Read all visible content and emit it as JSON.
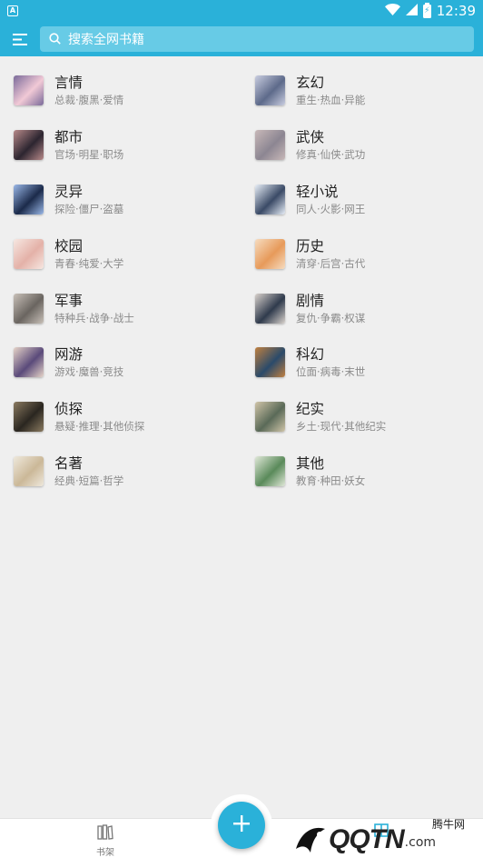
{
  "status_bar": {
    "app_icon_letter": "A",
    "time": "12:39",
    "icons": [
      "wifi-icon",
      "signal-icon",
      "battery-charging-icon"
    ]
  },
  "toolbar": {
    "menu_icon": "hamburger-menu-icon",
    "search_icon": "search-icon",
    "search_placeholder": "搜索全网书籍"
  },
  "categories": [
    {
      "name": "言情",
      "tags": "总裁·腹黑·爱情",
      "colors": [
        "#f1c9d6",
        "#7a6a9a"
      ]
    },
    {
      "name": "玄幻",
      "tags": "重生·热血·异能",
      "colors": [
        "#5d6a8a",
        "#c9cde0"
      ]
    },
    {
      "name": "都市",
      "tags": "官场·明星·职场",
      "colors": [
        "#2c2530",
        "#b88a8a"
      ]
    },
    {
      "name": "武侠",
      "tags": "修真·仙侠·武功",
      "colors": [
        "#8c8692",
        "#c8b8b8"
      ]
    },
    {
      "name": "灵异",
      "tags": "探险·僵尸·盗墓",
      "colors": [
        "#1b2a4a",
        "#9ab8e8"
      ]
    },
    {
      "name": "轻小说",
      "tags": "同人·火影·网王",
      "colors": [
        "#3a4a66",
        "#e7eef7"
      ]
    },
    {
      "name": "校园",
      "tags": "青春·纯爱·大学",
      "colors": [
        "#e4b1a8",
        "#f6e7e1"
      ]
    },
    {
      "name": "历史",
      "tags": "清穿·后宫·古代",
      "colors": [
        "#e79a5a",
        "#f6dcc0"
      ]
    },
    {
      "name": "军事",
      "tags": "特种兵·战争·战士",
      "colors": [
        "#6a6560",
        "#c8c0b8"
      ]
    },
    {
      "name": "剧情",
      "tags": "复仇·争霸·权谋",
      "colors": [
        "#2f3a4c",
        "#d9d2cc"
      ]
    },
    {
      "name": "网游",
      "tags": "游戏·魔兽·竞技",
      "colors": [
        "#5a4a7a",
        "#e6d4c8"
      ]
    },
    {
      "name": "科幻",
      "tags": "位面·病毒·末世",
      "colors": [
        "#2a4a6a",
        "#c08040"
      ]
    },
    {
      "name": "侦探",
      "tags": "悬疑·推理·其他侦探",
      "colors": [
        "#2a2620",
        "#8a7a60"
      ]
    },
    {
      "name": "纪实",
      "tags": "乡土·现代·其他纪实",
      "colors": [
        "#5a6a58",
        "#d0c4a8"
      ]
    },
    {
      "name": "名著",
      "tags": "经典·短篇·哲学",
      "colors": [
        "#cbb898",
        "#eee8dc"
      ]
    },
    {
      "name": "其他",
      "tags": "教育·种田·妖女",
      "colors": [
        "#5a8a5a",
        "#e0e8d8"
      ]
    }
  ],
  "bottom_nav": {
    "bookshelf_label": "书架",
    "bookshelf_icon": "bookshelf-icon",
    "add_icon": "plus-icon",
    "library_icon": "library-icon"
  },
  "watermark": {
    "logo_text": "QQTN",
    "suffix": ".com",
    "cn_text": "腾牛网"
  },
  "colors": {
    "accent": "#2ab1d9",
    "search_bg": "#67cbe6",
    "background": "#efefef"
  }
}
